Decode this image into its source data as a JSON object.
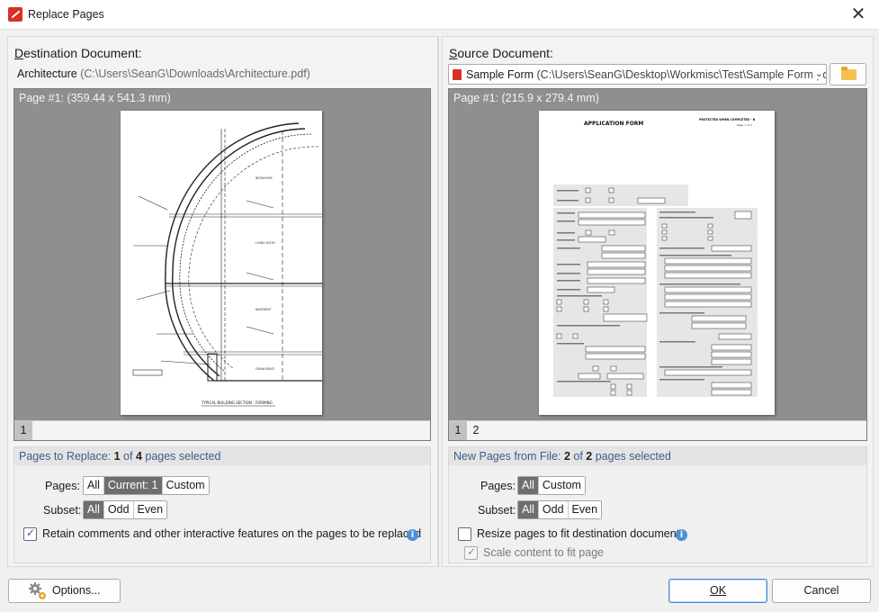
{
  "window": {
    "title": "Replace Pages",
    "close_glyph": "✕"
  },
  "destination": {
    "heading_first": "D",
    "heading_rest": "estination Document:",
    "file_name": "Architecture",
    "file_path": "(C:\\Users\\SeanG\\Downloads\\Architecture.pdf)",
    "preview_title": "Page #1:  (359.44 x 541.3 mm)",
    "thumbs": [
      "1"
    ],
    "drawing_title": "TYPICAL BUILDING SECTION - FORMING",
    "section_header_prefix": "Pages to Replace: ",
    "selected_count": "1",
    "of_text": " of ",
    "total_count": "4",
    "suffix_text": " pages selected",
    "pages_label": "Pages:",
    "pages_options": [
      "All",
      "Current: 1",
      "Custom"
    ],
    "subset_label": "Subset:",
    "subset_options": [
      "All",
      "Odd",
      "Even"
    ],
    "retain_label": "Retain comments and other interactive features on the pages to be replaced"
  },
  "source": {
    "heading_first": "S",
    "heading_rest": "ource Document:",
    "file_name": "Sample Form",
    "file_path": "(C:\\Users\\SeanG\\Desktop\\Workmisc\\Test\\Sample Form.pdf)",
    "preview_title": "Page #1:  (215.9 x 279.4 mm)",
    "thumbs": [
      "1",
      "2"
    ],
    "form_title": "APPLICATION FORM",
    "form_protected": "PROTECTED WHEN COMPLETED - B",
    "form_page": "Page 1 of 3",
    "section_header_prefix": "New Pages from File: ",
    "selected_count": "2",
    "of_text": " of ",
    "total_count": "2",
    "suffix_text": " pages selected",
    "pages_label": "Pages:",
    "pages_options": [
      "All",
      "Custom"
    ],
    "subset_label": "Subset:",
    "subset_options": [
      "All",
      "Odd",
      "Even"
    ],
    "resize_label": "Resize pages to fit destination document",
    "scale_label": "Scale content to fit page"
  },
  "footer": {
    "options_label": "Options...",
    "ok_label": "OK",
    "cancel_label": "Cancel"
  },
  "icons": {
    "app": "pdf-app-icon",
    "folder": "folder-icon",
    "info": "info-icon",
    "gear": "gear-icon"
  },
  "colors": {
    "accent": "#4a8bd6",
    "section_text": "#3c5c8c",
    "active_segment": "#6e6e6e",
    "preview_bg": "#8f8f8f",
    "app_red": "#d93025"
  }
}
